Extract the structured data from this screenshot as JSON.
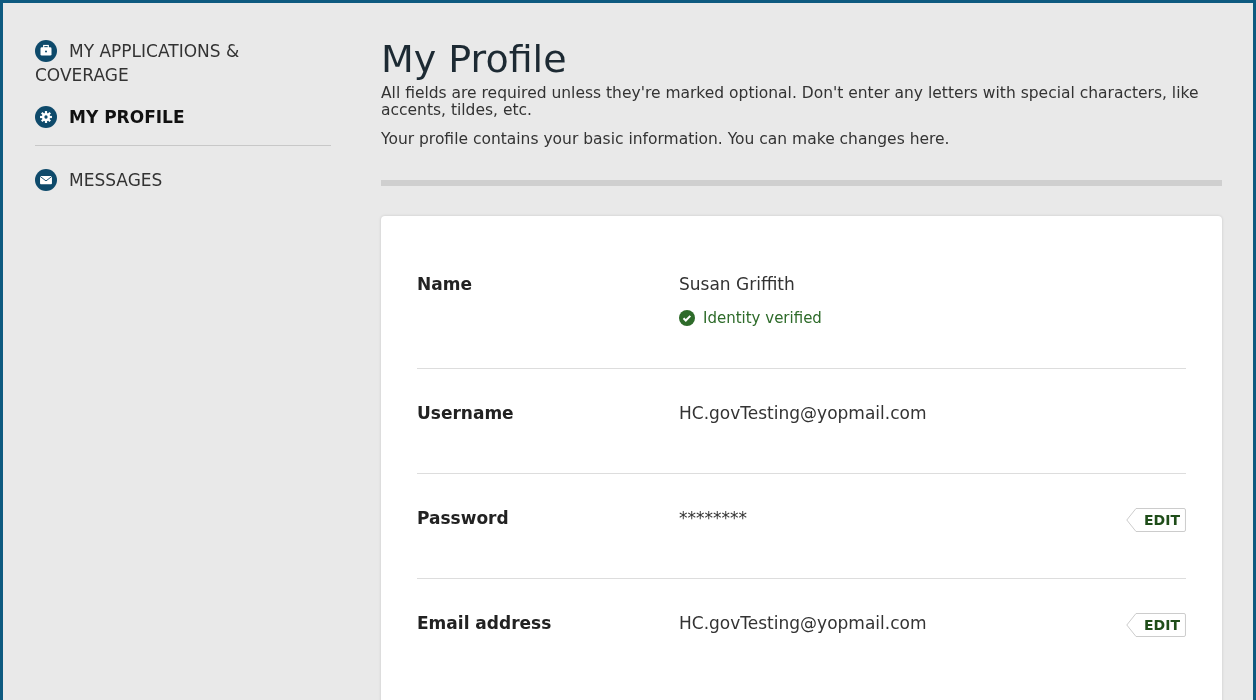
{
  "sidebar": {
    "items": [
      {
        "label": "MY APPLICATIONS & COVERAGE",
        "kind": "case",
        "selected": false
      },
      {
        "label": "MY PROFILE",
        "kind": "gear",
        "selected": true
      },
      {
        "label": "MESSAGES",
        "kind": "mail",
        "selected": false
      }
    ]
  },
  "page": {
    "title": "My Profile",
    "notes": [
      "All fields are required unless they're marked optional. Don't enter any letters with special characters, like accents, tildes, etc.",
      "Your profile contains your basic information. You can make changes here."
    ]
  },
  "profile": {
    "rows": [
      {
        "label": "Name",
        "value": "Susan Griffith",
        "verified": true,
        "status": "Identity verified",
        "editable": false
      },
      {
        "label": "Username",
        "value": "HC.govTesting@yopmail.com",
        "verified": false,
        "editable": false
      },
      {
        "label": "Password",
        "value": "********",
        "verified": false,
        "editable": true,
        "action": "EDIT"
      },
      {
        "label": "Email address",
        "value": "HC.govTesting@yopmail.com",
        "verified": false,
        "editable": true,
        "action": "EDIT"
      }
    ]
  }
}
